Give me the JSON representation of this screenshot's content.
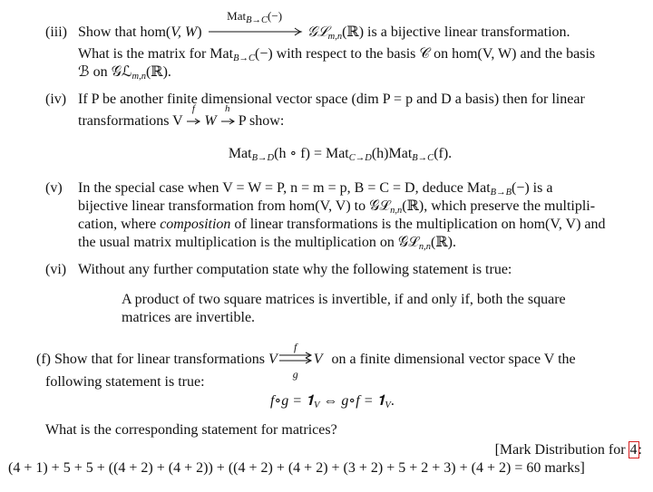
{
  "document": {
    "items": {
      "iii": {
        "label": "(iii)",
        "line1_pre": "Show that hom(",
        "line1_vars": "V, W",
        "line1_close": ")",
        "arrow_label": "Mat",
        "arrow_sub": "B→C",
        "arrow_arg": "(−)",
        "target_space": "𝒢ℒ",
        "target_sub": "m,n",
        "target_field": "(ℝ)",
        "line1_post": " is a bijective linear transformation.",
        "line2": "What is the matrix for Mat",
        "line2_sub": "B→C",
        "line2_post": "(−) with respect to the basis 𝒞 on hom(V, W) and the basis",
        "line3": "ℬ on 𝒢ℒ",
        "line3_sub": "m,n",
        "line3_post": "(ℝ)."
      },
      "iv": {
        "label": "(iv)",
        "line1": "If P be another finite dimensional vector space (dim P = p and D a basis) then for linear",
        "line2_pre": "transformations V",
        "arrow1": "f",
        "mid": "W",
        "arrow2": "h",
        "line2_post": "P show:",
        "equation_parts": [
          "Mat",
          "B→D",
          "(h ∘ f) = Mat",
          "C→D",
          "(h)Mat",
          "B→C",
          "(f)."
        ]
      },
      "v": {
        "label": "(v)",
        "line1": "In the special case when V = W = P, n = m = p, B = C = D, deduce Mat",
        "line1_sub": "B→B",
        "line1_post": "(−) is a",
        "line2": "bijective linear transformation from hom(V, V) to 𝒢ℒ",
        "line2_sub": "n,n",
        "line2_post": "(ℝ), which preserve the multipli-",
        "line3_pre": "cation, where ",
        "line3_em": "composition",
        "line3_post": " of linear transformations is the multiplication on hom(V, V) and",
        "line4": "the usual matrix multiplication is the multiplication on 𝒢ℒ",
        "line4_sub": "n,n",
        "line4_post": "(ℝ)."
      },
      "vi": {
        "label": "(vi)",
        "line1": "Without any further computation state why the following statement is true:",
        "quote1": "A product of two square matrices is invertible, if and only if, both the square",
        "quote2": "matrices are invertible."
      }
    },
    "part_f": {
      "label": "(f)",
      "line1_pre": "Show that for linear transformations",
      "space": "V",
      "arrow_top": "f",
      "arrow_bottom": "g",
      "line1_post": "on a finite dimensional vector space V the",
      "line2": "following statement is true:",
      "equation": "f∘g = 𝟏_V ⇔ g∘f = 𝟏_V.",
      "eq_f": "f∘g = 𝟏",
      "eq_sub1": "V",
      "eq_mid": " ⇔ g∘f = 𝟏",
      "eq_sub2": "V",
      "eq_end": ".",
      "question": "What is the corresponding statement for matrices?"
    },
    "marks": {
      "line1_pre": "[Mark Distribution for ",
      "boxed": "4",
      "line1_post": ":",
      "line2": "(4 + 1) + 5 + 5 + ((4 + 2) + (4 + 2)) + ((4 + 2) + (4 + 2) + (3 + 2) + 5 + 2 + 3) + (4 + 2) = 60 marks]",
      "highlight_color": "#d62020"
    }
  }
}
